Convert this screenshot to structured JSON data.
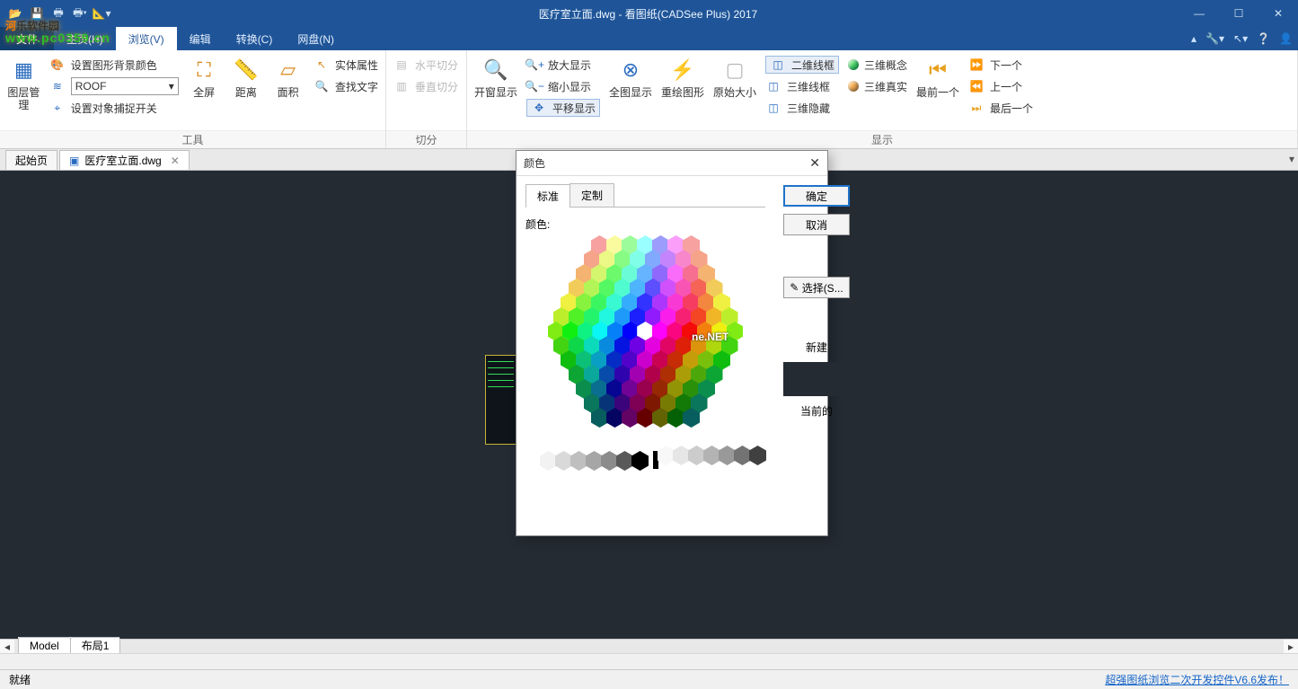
{
  "window": {
    "title": "医疗室立面.dwg - 看图纸(CADSee Plus) 2017"
  },
  "menu": {
    "file": "文件",
    "items": [
      "主页(H)",
      "浏览(V)",
      "编辑",
      "转换(C)",
      "网盘(N)"
    ]
  },
  "ribbon": {
    "group_tools": "工具",
    "group_split": "切分",
    "group_display": "显示",
    "layer_mgmt": "图层管理",
    "set_bg_color": "设置图形背景颜色",
    "set_snap": "设置对象捕捉开关",
    "layer_value": "ROOF",
    "fullscreen": "全屏",
    "distance": "距离",
    "area": "面积",
    "entity_attr": "实体属性",
    "find_text": "查找文字",
    "hsplit": "水平切分",
    "vsplit": "垂直切分",
    "open_window": "开窗显示",
    "zoom_in": "放大显示",
    "zoom_out": "缩小显示",
    "pan": "平移显示",
    "zoom_all": "全图显示",
    "redraw": "重绘图形",
    "original_size": "原始大小",
    "wf2d": "二维线框",
    "wf3d": "三维线框",
    "hide3d": "三维隐藏",
    "concept3d": "三维概念",
    "real3d": "三维真实",
    "first": "最前一个",
    "next": "下一个",
    "prev": "上一个",
    "last": "最后一个"
  },
  "doctabs": {
    "start": "起始页",
    "file": "医疗室立面.dwg"
  },
  "modeltabs": {
    "model": "Model",
    "layout": "布局1"
  },
  "status": {
    "ready": "就绪",
    "link": "超强图纸浏览二次开发控件V6.6发布！"
  },
  "dialog": {
    "title": "颜色",
    "tab_standard": "标准",
    "tab_custom": "定制",
    "colors_label": "颜色:",
    "ok": "确定",
    "cancel": "取消",
    "pick": "选择(S...",
    "new": "新建",
    "current": "当前的"
  },
  "watermark": {
    "brand_a": "河",
    "brand_b": "乐软件园",
    "url": "www.pc0359.cn",
    "net": "ne.NET"
  }
}
